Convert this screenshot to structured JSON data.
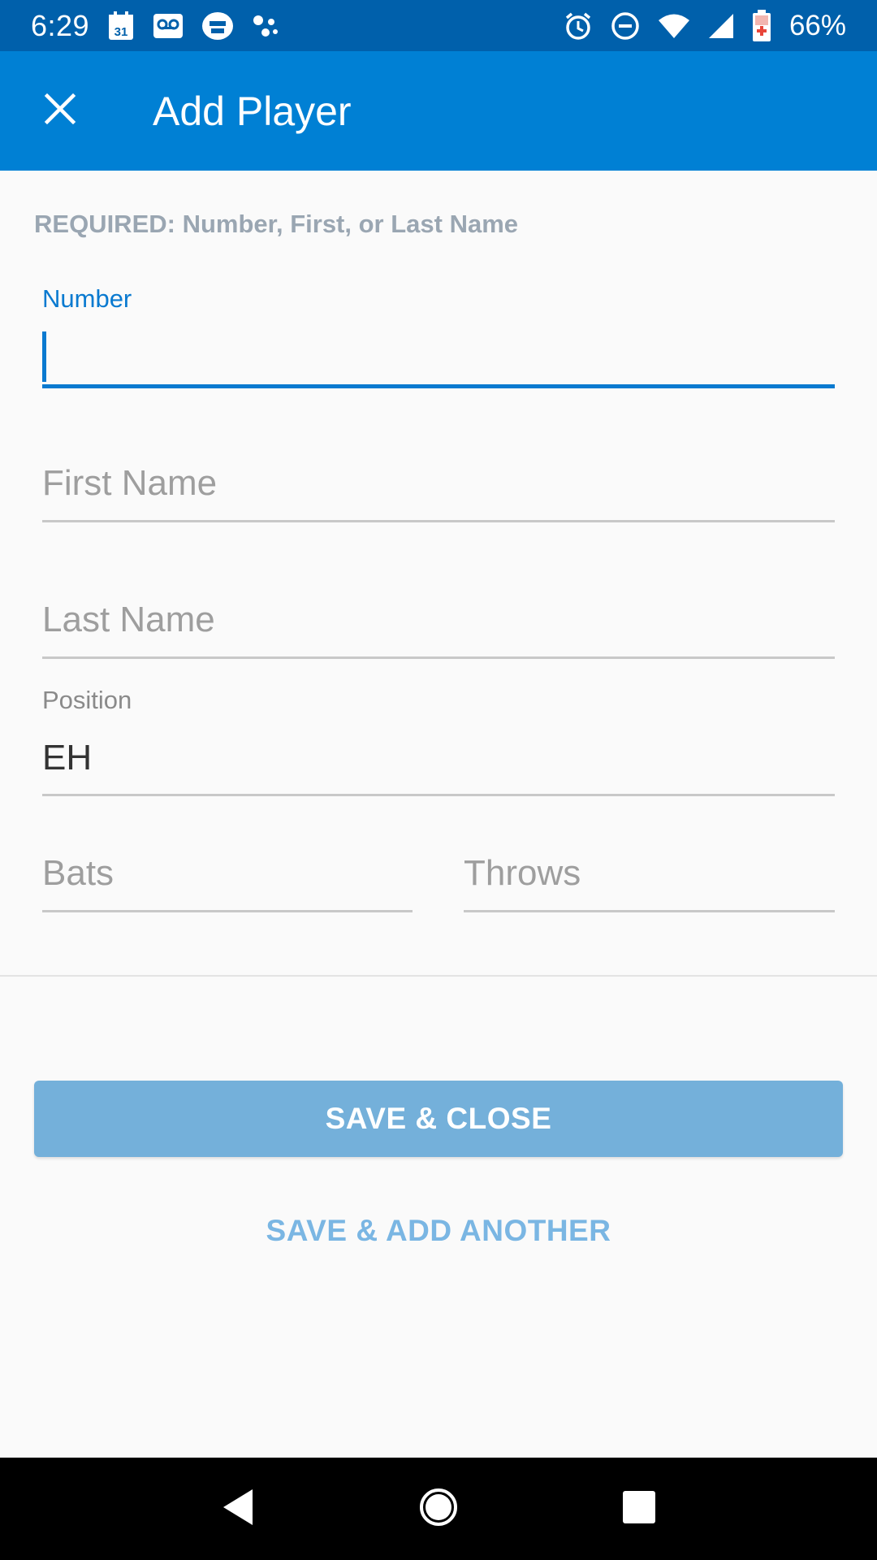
{
  "status_bar": {
    "time": "6:29",
    "calendar_day": "31",
    "battery_percent": "66%",
    "left_icons": [
      "calendar-icon",
      "voicemail-icon",
      "printer-icon",
      "assistant-dots-icon"
    ],
    "right_icons": [
      "alarm-icon",
      "do-not-disturb-icon",
      "wifi-icon",
      "signal-icon",
      "battery-icon"
    ]
  },
  "app_bar": {
    "title": "Add Player",
    "close_icon": "close-icon"
  },
  "form": {
    "required_note": "REQUIRED: Number, First, or Last Name",
    "number": {
      "label": "Number",
      "value": ""
    },
    "first_name": {
      "placeholder": "First Name",
      "value": ""
    },
    "last_name": {
      "placeholder": "Last Name",
      "value": ""
    },
    "position": {
      "label": "Position",
      "value": "EH"
    },
    "bats": {
      "placeholder": "Bats",
      "value": ""
    },
    "throws": {
      "placeholder": "Throws",
      "value": ""
    }
  },
  "actions": {
    "save_close": "SAVE & CLOSE",
    "save_add_another": "SAVE & ADD ANOTHER"
  },
  "nav_bar": {
    "icons": [
      "back-icon",
      "home-icon",
      "recents-icon"
    ]
  },
  "colors": {
    "status_bar": "#0060ab",
    "app_bar": "#0080d4",
    "accent": "#0a7ad0",
    "primary_button": "#74b0da",
    "text_button": "#7ab6e3"
  }
}
